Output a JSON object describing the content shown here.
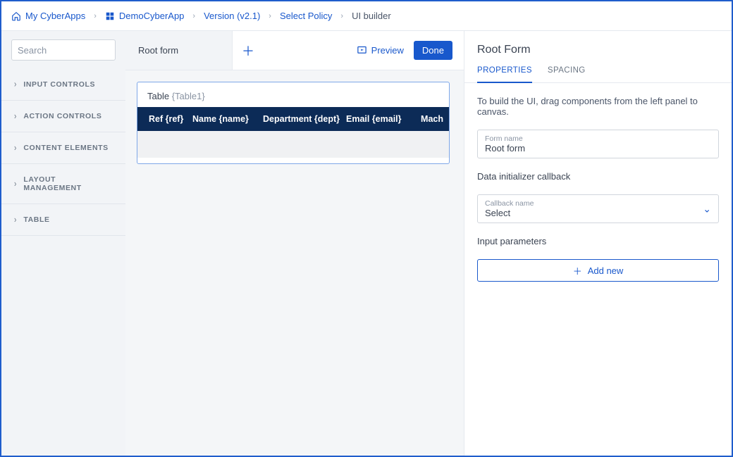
{
  "breadcrumbs": {
    "home": "My CyberApps",
    "app": "DemoCyberApp",
    "version": "Version (v2.1)",
    "policy": "Select Policy",
    "current": "UI builder"
  },
  "left": {
    "search_placeholder": "Search",
    "groups": [
      "INPUT CONTROLS",
      "ACTION CONTROLS",
      "CONTENT ELEMENTS",
      "LAYOUT MANAGEMENT",
      "TABLE"
    ]
  },
  "center": {
    "form_tab": "Root form",
    "preview_label": "Preview",
    "done_label": "Done",
    "card": {
      "type": "Table",
      "id": "{Table1}",
      "columns": [
        "Ref {ref}",
        "Name {name}",
        "Department {dept}",
        "Email {email}",
        "Mach"
      ]
    }
  },
  "right": {
    "title": "Root Form",
    "tabs": {
      "properties": "PROPERTIES",
      "spacing": "SPACING"
    },
    "hint": "To build the UI, drag components from the left panel to canvas.",
    "form_name_label": "Form name",
    "form_name_value": "Root form",
    "callback_section": "Data initializer callback",
    "callback_label": "Callback name",
    "callback_value": "Select",
    "params_label": "Input parameters",
    "add_new": "Add new"
  }
}
